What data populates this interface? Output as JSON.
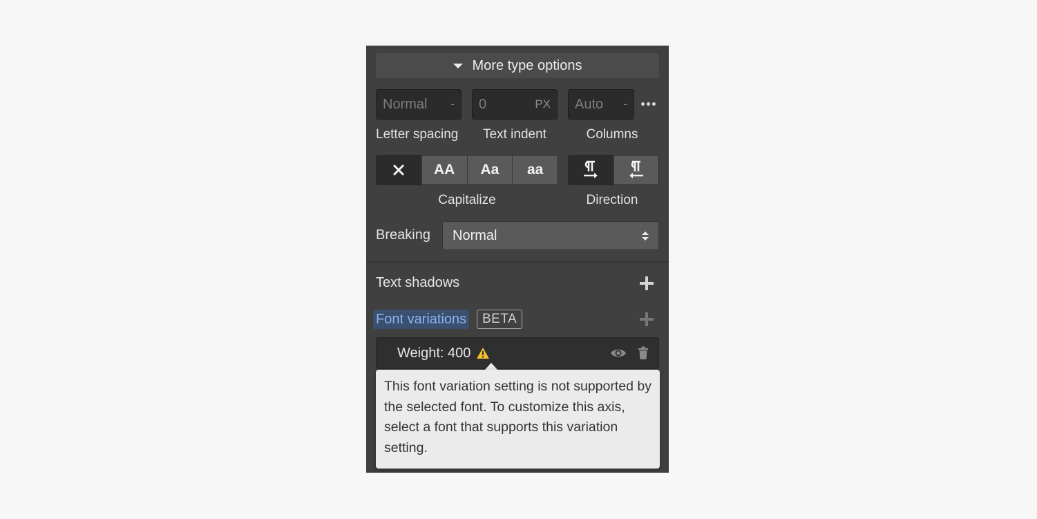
{
  "header": {
    "label": "More type options"
  },
  "fields": {
    "letter_spacing": {
      "value": "Normal",
      "unit": "-",
      "label": "Letter spacing"
    },
    "text_indent": {
      "value": "0",
      "unit": "PX",
      "label": "Text indent"
    },
    "columns": {
      "value": "Auto",
      "unit": "-",
      "label": "Columns"
    }
  },
  "capitalize": {
    "label": "Capitalize",
    "options": [
      "none-icon",
      "AA",
      "Aa",
      "aa"
    ],
    "labels": {
      "upper": "AA",
      "title": "Aa",
      "lower": "aa"
    },
    "selected": "none"
  },
  "direction": {
    "label": "Direction",
    "options": [
      "ltr-icon",
      "rtl-icon"
    ],
    "selected": "ltr"
  },
  "breaking": {
    "label": "Breaking",
    "value": "Normal"
  },
  "text_shadows": {
    "label": "Text shadows"
  },
  "font_variations": {
    "label": "Font variations",
    "badge": "BETA",
    "weight_label": "Weight: 400"
  },
  "tooltip": {
    "text": "This font variation setting is not supported by the selected font. To customize this axis, select a font that supports this variation setting."
  },
  "colors": {
    "panel_bg": "#404040",
    "accent_blue": "#8ab4f0",
    "warning": "#f0c02c",
    "tooltip_bg": "#ebebeb"
  }
}
